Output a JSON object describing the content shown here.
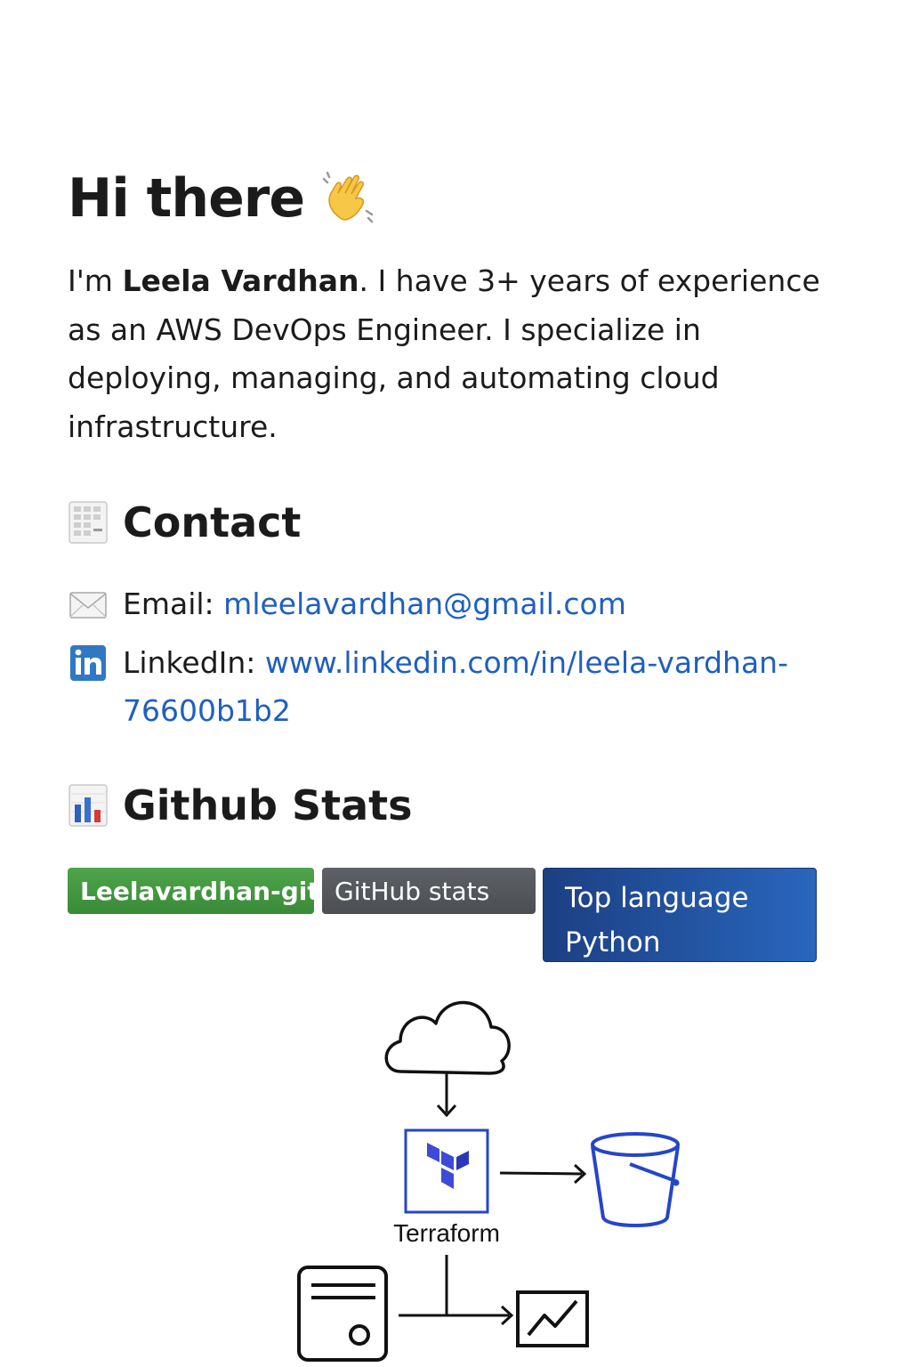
{
  "heading": {
    "title": "Hi there",
    "wave_icon": "waving-hand-icon"
  },
  "intro": {
    "prefix": "I'm ",
    "name": "Leela Vardhan",
    "rest": ". I have 3+ years of experience as an AWS DevOps Engineer. I specialize in deploying, managing, and automating cloud infrastructure."
  },
  "contact": {
    "heading": "Contact",
    "heading_icon": "contact-card-icon",
    "email_label": "Email: ",
    "email_value": "mleelavardhan@gmail.com",
    "email_icon": "envelope-icon",
    "linkedin_label": "LinkedIn: ",
    "linkedin_value": "www.linkedin.com/in/leela-vardhan-76600b1b2",
    "linkedin_icon": "linkedin-icon"
  },
  "github_stats": {
    "heading": "Github Stats",
    "heading_icon": "bar-chart-icon",
    "badges": [
      {
        "text": "Leelavardhan-git",
        "color": "#3f9440"
      },
      {
        "text": "GitHub stats",
        "color": "#55585c"
      },
      {
        "line1": "Top language",
        "line2": "Python",
        "color": "#1f4f9e"
      }
    ]
  },
  "diagram": {
    "label": "Terraform",
    "icons": [
      "cloud-icon",
      "terraform-icon",
      "bucket-icon",
      "server-icon",
      "monitoring-chart-icon"
    ],
    "accent": "#2546c9"
  }
}
